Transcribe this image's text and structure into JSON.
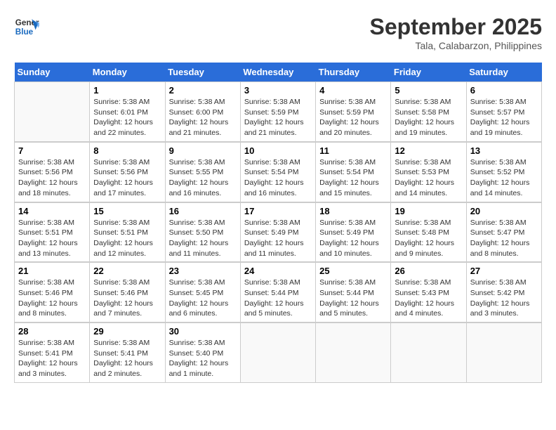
{
  "header": {
    "logo_general": "General",
    "logo_blue": "Blue",
    "month_title": "September 2025",
    "location": "Tala, Calabarzon, Philippines"
  },
  "weekdays": [
    "Sunday",
    "Monday",
    "Tuesday",
    "Wednesday",
    "Thursday",
    "Friday",
    "Saturday"
  ],
  "weeks": [
    [
      {
        "day": "",
        "empty": true
      },
      {
        "day": "1",
        "sunrise": "Sunrise: 5:38 AM",
        "sunset": "Sunset: 6:01 PM",
        "daylight": "Daylight: 12 hours and 22 minutes."
      },
      {
        "day": "2",
        "sunrise": "Sunrise: 5:38 AM",
        "sunset": "Sunset: 6:00 PM",
        "daylight": "Daylight: 12 hours and 21 minutes."
      },
      {
        "day": "3",
        "sunrise": "Sunrise: 5:38 AM",
        "sunset": "Sunset: 5:59 PM",
        "daylight": "Daylight: 12 hours and 21 minutes."
      },
      {
        "day": "4",
        "sunrise": "Sunrise: 5:38 AM",
        "sunset": "Sunset: 5:59 PM",
        "daylight": "Daylight: 12 hours and 20 minutes."
      },
      {
        "day": "5",
        "sunrise": "Sunrise: 5:38 AM",
        "sunset": "Sunset: 5:58 PM",
        "daylight": "Daylight: 12 hours and 19 minutes."
      },
      {
        "day": "6",
        "sunrise": "Sunrise: 5:38 AM",
        "sunset": "Sunset: 5:57 PM",
        "daylight": "Daylight: 12 hours and 19 minutes."
      }
    ],
    [
      {
        "day": "7",
        "sunrise": "Sunrise: 5:38 AM",
        "sunset": "Sunset: 5:56 PM",
        "daylight": "Daylight: 12 hours and 18 minutes."
      },
      {
        "day": "8",
        "sunrise": "Sunrise: 5:38 AM",
        "sunset": "Sunset: 5:56 PM",
        "daylight": "Daylight: 12 hours and 17 minutes."
      },
      {
        "day": "9",
        "sunrise": "Sunrise: 5:38 AM",
        "sunset": "Sunset: 5:55 PM",
        "daylight": "Daylight: 12 hours and 16 minutes."
      },
      {
        "day": "10",
        "sunrise": "Sunrise: 5:38 AM",
        "sunset": "Sunset: 5:54 PM",
        "daylight": "Daylight: 12 hours and 16 minutes."
      },
      {
        "day": "11",
        "sunrise": "Sunrise: 5:38 AM",
        "sunset": "Sunset: 5:54 PM",
        "daylight": "Daylight: 12 hours and 15 minutes."
      },
      {
        "day": "12",
        "sunrise": "Sunrise: 5:38 AM",
        "sunset": "Sunset: 5:53 PM",
        "daylight": "Daylight: 12 hours and 14 minutes."
      },
      {
        "day": "13",
        "sunrise": "Sunrise: 5:38 AM",
        "sunset": "Sunset: 5:52 PM",
        "daylight": "Daylight: 12 hours and 14 minutes."
      }
    ],
    [
      {
        "day": "14",
        "sunrise": "Sunrise: 5:38 AM",
        "sunset": "Sunset: 5:51 PM",
        "daylight": "Daylight: 12 hours and 13 minutes."
      },
      {
        "day": "15",
        "sunrise": "Sunrise: 5:38 AM",
        "sunset": "Sunset: 5:51 PM",
        "daylight": "Daylight: 12 hours and 12 minutes."
      },
      {
        "day": "16",
        "sunrise": "Sunrise: 5:38 AM",
        "sunset": "Sunset: 5:50 PM",
        "daylight": "Daylight: 12 hours and 11 minutes."
      },
      {
        "day": "17",
        "sunrise": "Sunrise: 5:38 AM",
        "sunset": "Sunset: 5:49 PM",
        "daylight": "Daylight: 12 hours and 11 minutes."
      },
      {
        "day": "18",
        "sunrise": "Sunrise: 5:38 AM",
        "sunset": "Sunset: 5:49 PM",
        "daylight": "Daylight: 12 hours and 10 minutes."
      },
      {
        "day": "19",
        "sunrise": "Sunrise: 5:38 AM",
        "sunset": "Sunset: 5:48 PM",
        "daylight": "Daylight: 12 hours and 9 minutes."
      },
      {
        "day": "20",
        "sunrise": "Sunrise: 5:38 AM",
        "sunset": "Sunset: 5:47 PM",
        "daylight": "Daylight: 12 hours and 8 minutes."
      }
    ],
    [
      {
        "day": "21",
        "sunrise": "Sunrise: 5:38 AM",
        "sunset": "Sunset: 5:46 PM",
        "daylight": "Daylight: 12 hours and 8 minutes."
      },
      {
        "day": "22",
        "sunrise": "Sunrise: 5:38 AM",
        "sunset": "Sunset: 5:46 PM",
        "daylight": "Daylight: 12 hours and 7 minutes."
      },
      {
        "day": "23",
        "sunrise": "Sunrise: 5:38 AM",
        "sunset": "Sunset: 5:45 PM",
        "daylight": "Daylight: 12 hours and 6 minutes."
      },
      {
        "day": "24",
        "sunrise": "Sunrise: 5:38 AM",
        "sunset": "Sunset: 5:44 PM",
        "daylight": "Daylight: 12 hours and 5 minutes."
      },
      {
        "day": "25",
        "sunrise": "Sunrise: 5:38 AM",
        "sunset": "Sunset: 5:44 PM",
        "daylight": "Daylight: 12 hours and 5 minutes."
      },
      {
        "day": "26",
        "sunrise": "Sunrise: 5:38 AM",
        "sunset": "Sunset: 5:43 PM",
        "daylight": "Daylight: 12 hours and 4 minutes."
      },
      {
        "day": "27",
        "sunrise": "Sunrise: 5:38 AM",
        "sunset": "Sunset: 5:42 PM",
        "daylight": "Daylight: 12 hours and 3 minutes."
      }
    ],
    [
      {
        "day": "28",
        "sunrise": "Sunrise: 5:38 AM",
        "sunset": "Sunset: 5:41 PM",
        "daylight": "Daylight: 12 hours and 3 minutes."
      },
      {
        "day": "29",
        "sunrise": "Sunrise: 5:38 AM",
        "sunset": "Sunset: 5:41 PM",
        "daylight": "Daylight: 12 hours and 2 minutes."
      },
      {
        "day": "30",
        "sunrise": "Sunrise: 5:38 AM",
        "sunset": "Sunset: 5:40 PM",
        "daylight": "Daylight: 12 hours and 1 minute."
      },
      {
        "day": "",
        "empty": true
      },
      {
        "day": "",
        "empty": true
      },
      {
        "day": "",
        "empty": true
      },
      {
        "day": "",
        "empty": true
      }
    ]
  ]
}
